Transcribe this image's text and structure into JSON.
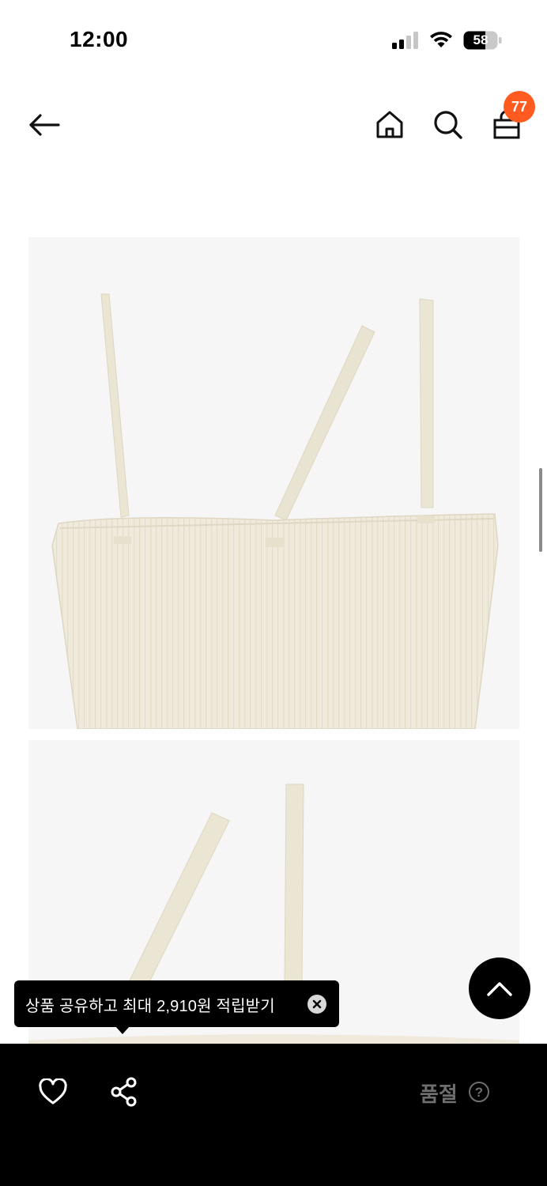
{
  "status_bar": {
    "time": "12:00",
    "battery_level": "58"
  },
  "header": {
    "icons": [
      "arrow-left-icon",
      "home-icon",
      "search-icon",
      "shopping-bag-icon"
    ],
    "cart_count": "77"
  },
  "product_images": [
    {
      "description_icon": "camisole-top-image"
    },
    {
      "description_icon": "camisole-strap-image"
    }
  ],
  "tooltip": {
    "text": "상품 공유하고 최대 2,910원 적립받기"
  },
  "bottom_bar": {
    "status_label": "품절",
    "help_symbol": "?"
  },
  "colors": {
    "badge": "#ff5a1f",
    "garment": "#efeadb",
    "bottom_bar": "#000000",
    "disabled_text": "#6e6e6e"
  }
}
